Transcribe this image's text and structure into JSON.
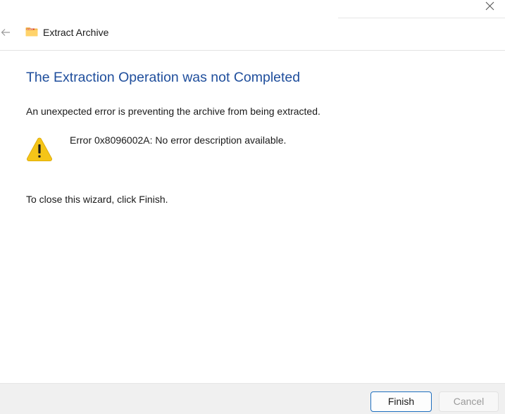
{
  "window": {
    "title": "Extract Archive",
    "close_icon": "close-icon",
    "back_icon": "back-arrow-icon",
    "app_icon": "zip-folder-icon"
  },
  "content": {
    "heading": "The Extraction Operation was not Completed",
    "message": "An unexpected error is preventing the archive from being extracted.",
    "error_icon": "warning-icon",
    "error_text": "Error 0x8096002A: No error description available.",
    "close_hint": "To close this wizard, click Finish."
  },
  "buttons": {
    "finish_label": "Finish",
    "cancel_label": "Cancel"
  },
  "colors": {
    "heading": "#1f4e9c",
    "accent_border": "#1f6fbf",
    "warning_fill": "#f5c518",
    "footer_bg": "#f0f0f0"
  }
}
